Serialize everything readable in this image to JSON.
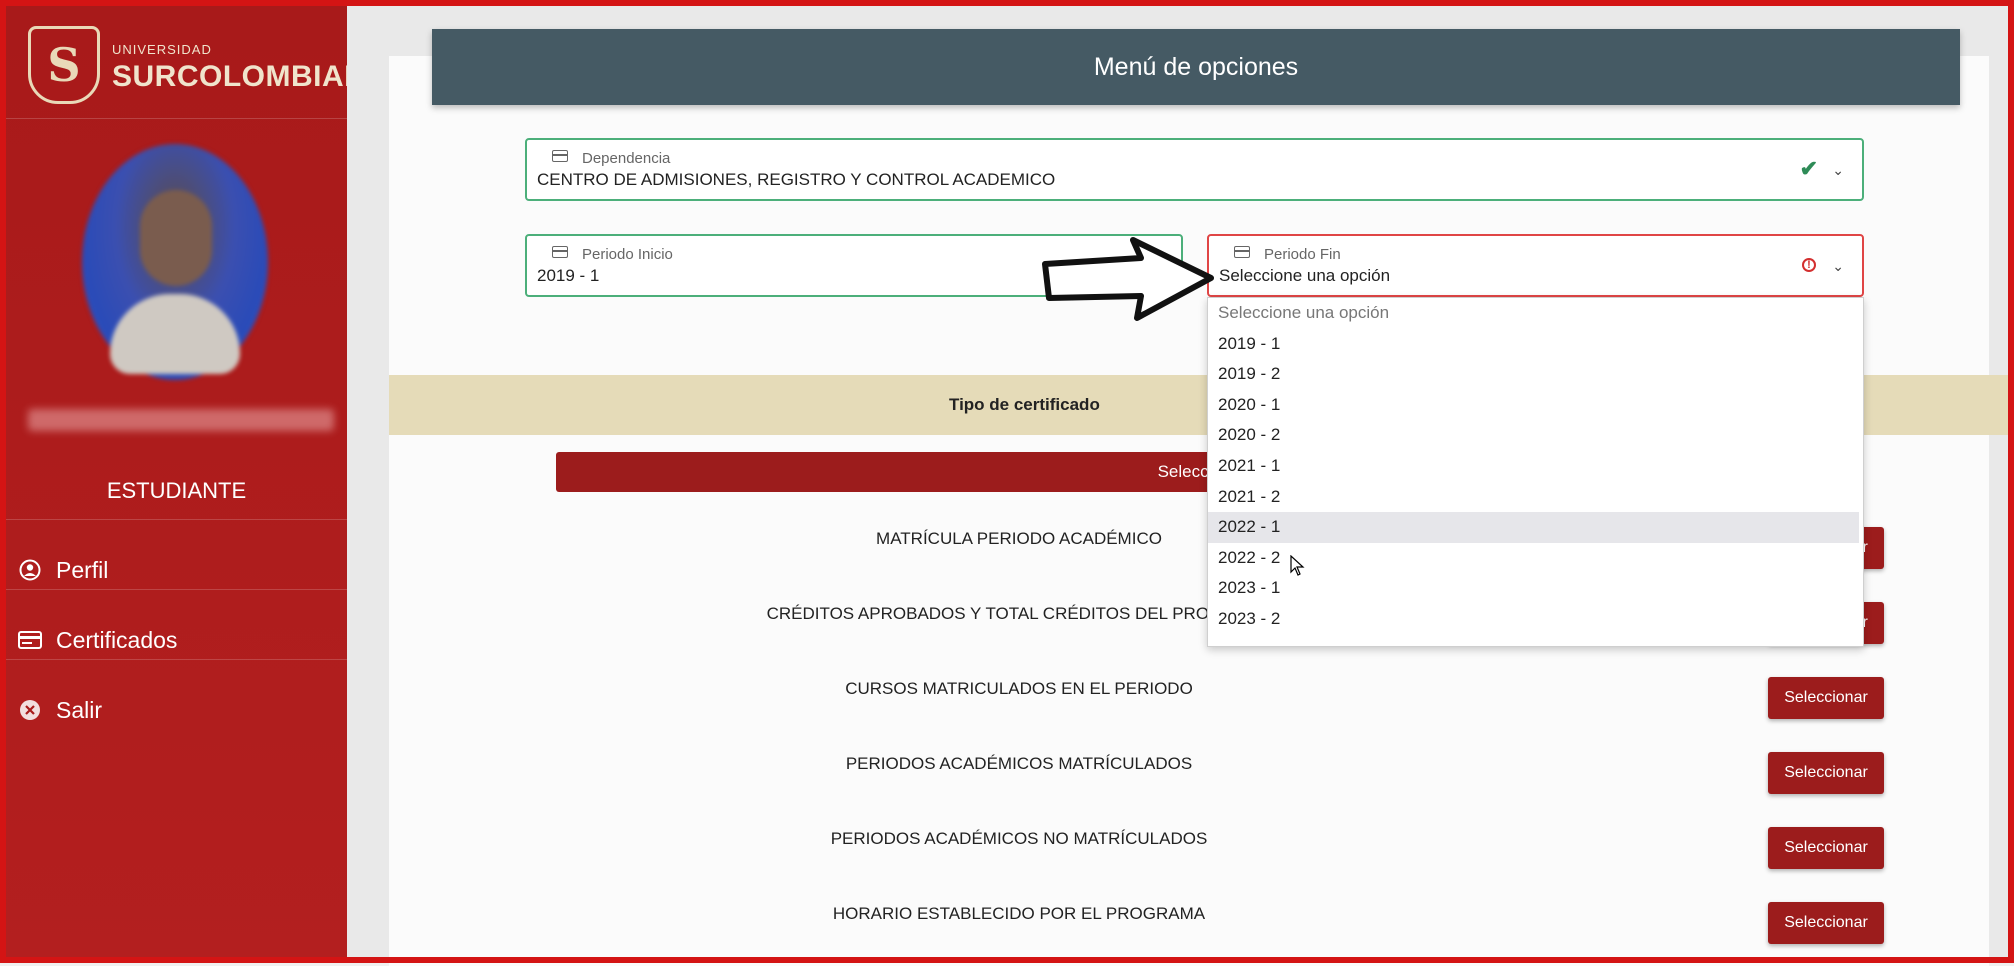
{
  "brand": {
    "small": "UNIVERSIDAD",
    "big": "SURCOLOMBIANA",
    "shield_letter": "S"
  },
  "user": {
    "role": "ESTUDIANTE"
  },
  "nav": [
    {
      "label": "Perfil",
      "icon": "user-circle-icon"
    },
    {
      "label": "Certificados",
      "icon": "card-icon"
    },
    {
      "label": "Salir",
      "icon": "close-circle-icon"
    }
  ],
  "header": {
    "title": "Menú de opciones"
  },
  "dependencia": {
    "label": "Dependencia",
    "value": "CENTRO DE ADMISIONES, REGISTRO Y CONTROL ACADEMICO"
  },
  "periodo_inicio": {
    "label": "Periodo Inicio",
    "value": "2019 - 1"
  },
  "periodo_fin": {
    "label": "Periodo Fin",
    "value": "Seleccione una opción",
    "options": [
      "Seleccione una opción",
      "2019 - 1",
      "2019 - 2",
      "2020 - 1",
      "2020 - 2",
      "2021 - 1",
      "2021 - 2",
      "2022 - 1",
      "2022 - 2",
      "2023 - 1",
      "2023 - 2"
    ]
  },
  "tipo_certificado": {
    "label": "Tipo de certificado",
    "select_all": "Seleccionar"
  },
  "certificados": [
    {
      "name": "MATRÍCULA PERIODO ACADÉMICO",
      "button": "Seleccionar"
    },
    {
      "name": "CRÉDITOS APROBADOS Y TOTAL CRÉDITOS DEL PROGRAMA",
      "button": "Seleccionar"
    },
    {
      "name": "CURSOS MATRICULADOS EN EL PERIODO",
      "button": "Seleccionar"
    },
    {
      "name": "PERIODOS ACADÉMICOS MATRÍCULADOS",
      "button": "Seleccionar"
    },
    {
      "name": "PERIODOS ACADÉMICOS NO MATRÍCULADOS",
      "button": "Seleccionar"
    },
    {
      "name": "HORARIO ESTABLECIDO POR EL PROGRAMA",
      "button": "Seleccionar"
    }
  ],
  "colors": {
    "primary": "#9c1c1c",
    "header": "#455a64",
    "tipo_bar": "#e5dbb8"
  }
}
